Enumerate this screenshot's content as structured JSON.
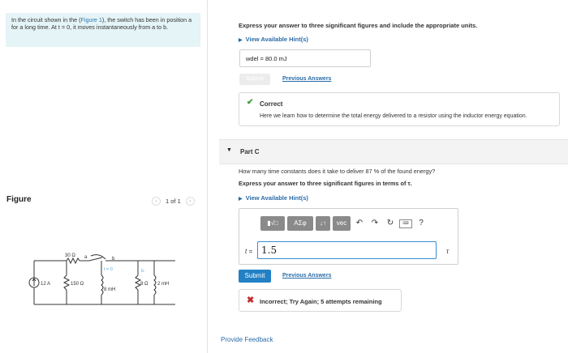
{
  "problem": {
    "text_before_link": "In the circuit shown in the (",
    "link": "Figure 1",
    "text_after_link": "), the switch has been in position a for a long time. At t = 0, it moves instantaneously from a to b."
  },
  "figure": {
    "title": "Figure",
    "pager": "1 of 1",
    "labels": {
      "r1": "30 Ω",
      "a": "a",
      "b": "b",
      "t0": "t = 0",
      "src": "12 A",
      "r2": "150 Ω",
      "l1": "8 mH",
      "r3": "8 Ω",
      "l2": "2 mH",
      "iL": "iL"
    }
  },
  "part_b": {
    "instructions": "Express your answer to three significant figures and include the appropriate units.",
    "hint_link": "View Available Hint(s)",
    "answer_var": "wdel =",
    "answer_value": "80.0 mJ",
    "submit_label": "Submit",
    "previous_answers": "Previous Answers",
    "correct_title": "Correct",
    "correct_text": "Here we learn how to determine the total energy delivered to a resistor using the inductor energy equation."
  },
  "part_c": {
    "label": "Part C",
    "question": "How many time constants does it take to deliver 87 % of the found energy?",
    "instructions": "Express your answer to three significant figures in terms of τ.",
    "hint_link": "View Available Hint(s)",
    "toolbar": {
      "template": "▮√□",
      "greek": "ΑΣφ",
      "arrows": "↓↑",
      "vec": "vec",
      "undo": "↶",
      "redo": "↷",
      "reset": "↻",
      "keyboard": "⌨",
      "help": "?"
    },
    "var_label": "t =",
    "input_value": "1.5",
    "unit": "τ",
    "submit_label": "Submit",
    "previous_answers": "Previous Answers",
    "feedback": "Incorrect; Try Again; 5 attempts remaining"
  },
  "footer": {
    "provide_feedback": "Provide Feedback"
  },
  "colors": {
    "link": "#2a6ca8",
    "submit": "#2380c4",
    "correct": "#3a9a3a",
    "incorrect": "#c62b2b",
    "problem_bg": "#e5f4f6"
  }
}
